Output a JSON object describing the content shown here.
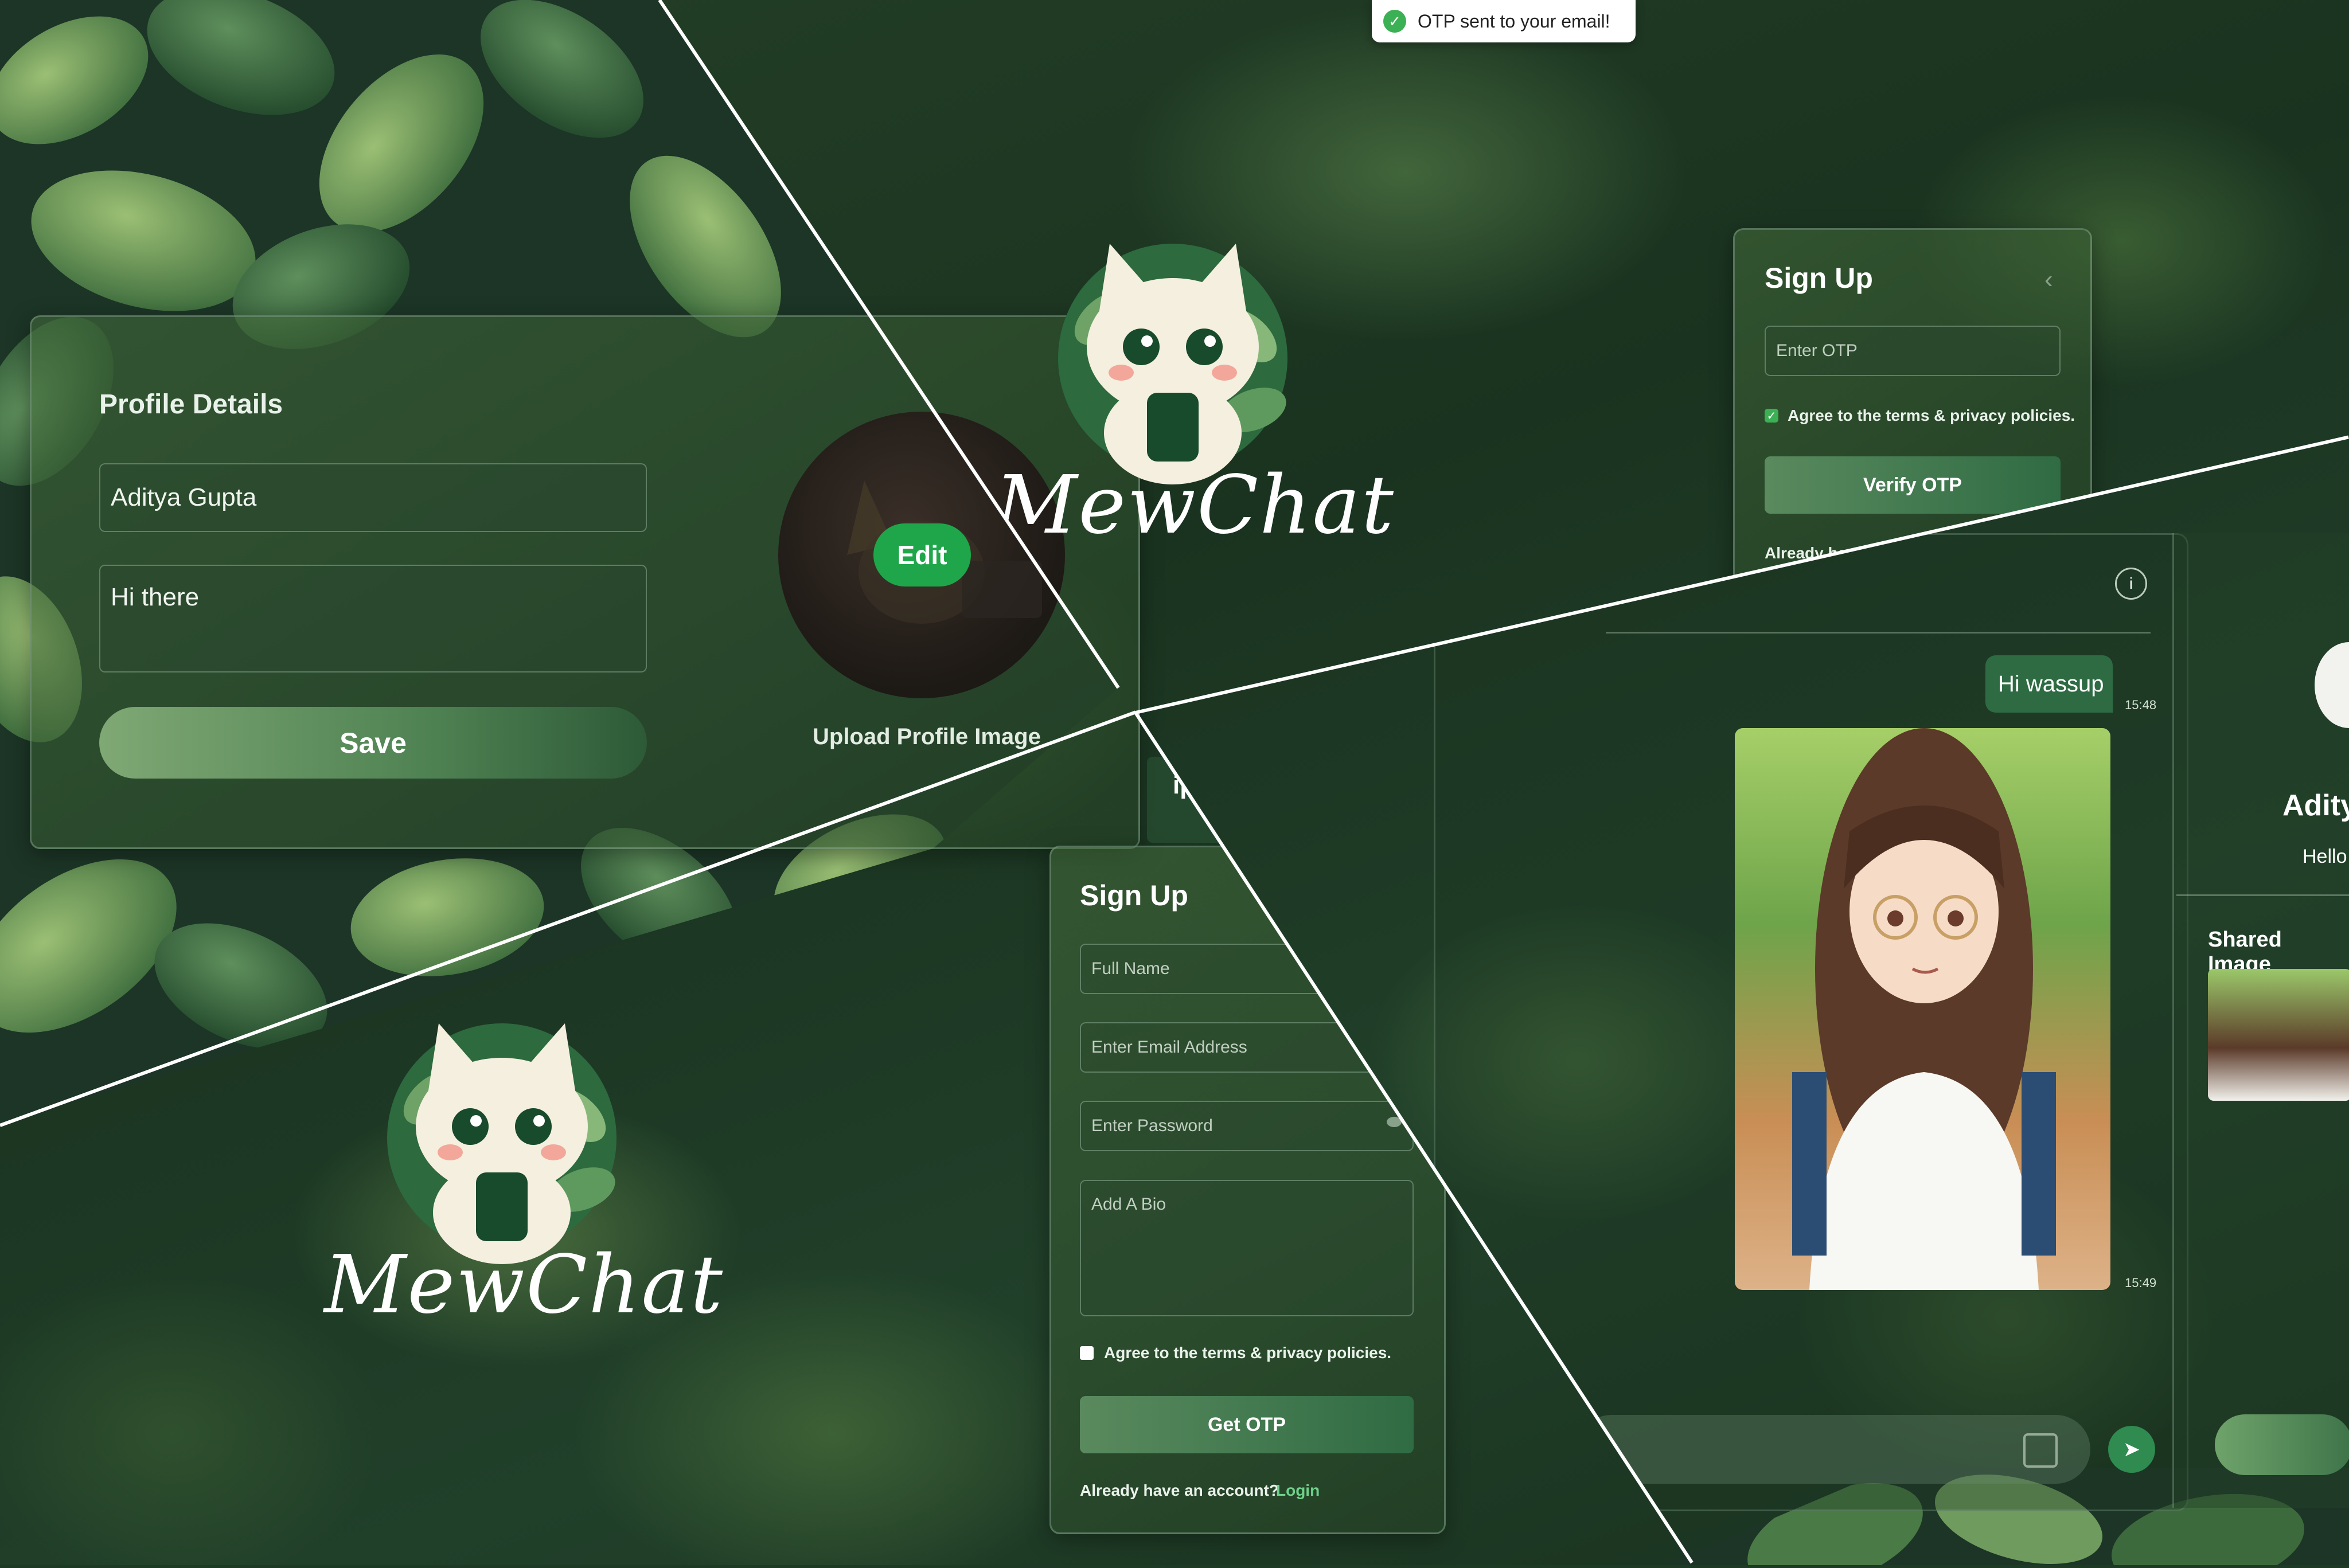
{
  "toast": {
    "message": "OTP sent to your email!",
    "icon": "check-circle-icon"
  },
  "profile": {
    "heading": "Profile Details",
    "name_value": "Aditya Gupta",
    "bio_value": "Hi there",
    "save_label": "Save",
    "edit_label": "Edit",
    "upload_label": "Upload Profile Image",
    "partial_name": "ipta"
  },
  "logo": {
    "text": "MewChat"
  },
  "otp_signup": {
    "heading": "Sign Up",
    "otp_placeholder": "Enter OTP",
    "terms_label": "Agree to the terms & privacy policies.",
    "terms_checked": true,
    "verify_label": "Verify OTP",
    "account_prompt": "Already have an account?"
  },
  "signup": {
    "heading": "Sign Up",
    "full_name_placeholder": "Full Name",
    "email_placeholder": "Enter Email Address",
    "password_placeholder": "Enter Password",
    "bio_placeholder": "Add A Bio",
    "terms_label": "Agree to the terms & privacy policies.",
    "terms_checked": false,
    "get_otp_label": "Get OTP",
    "account_prompt": "Already have an account?",
    "login_link": "Login"
  },
  "chat": {
    "message_text": "Hi wassup",
    "message_time": "15:48",
    "image_time": "15:49",
    "profile_name": "Adity",
    "profile_bio": "Hello",
    "shared_images_label": "Shared Image"
  },
  "colors": {
    "accent": "#2f6b43",
    "toast_check": "#3cb054",
    "edit_button": "#1fa64a",
    "login_link": "#6fd18a"
  }
}
